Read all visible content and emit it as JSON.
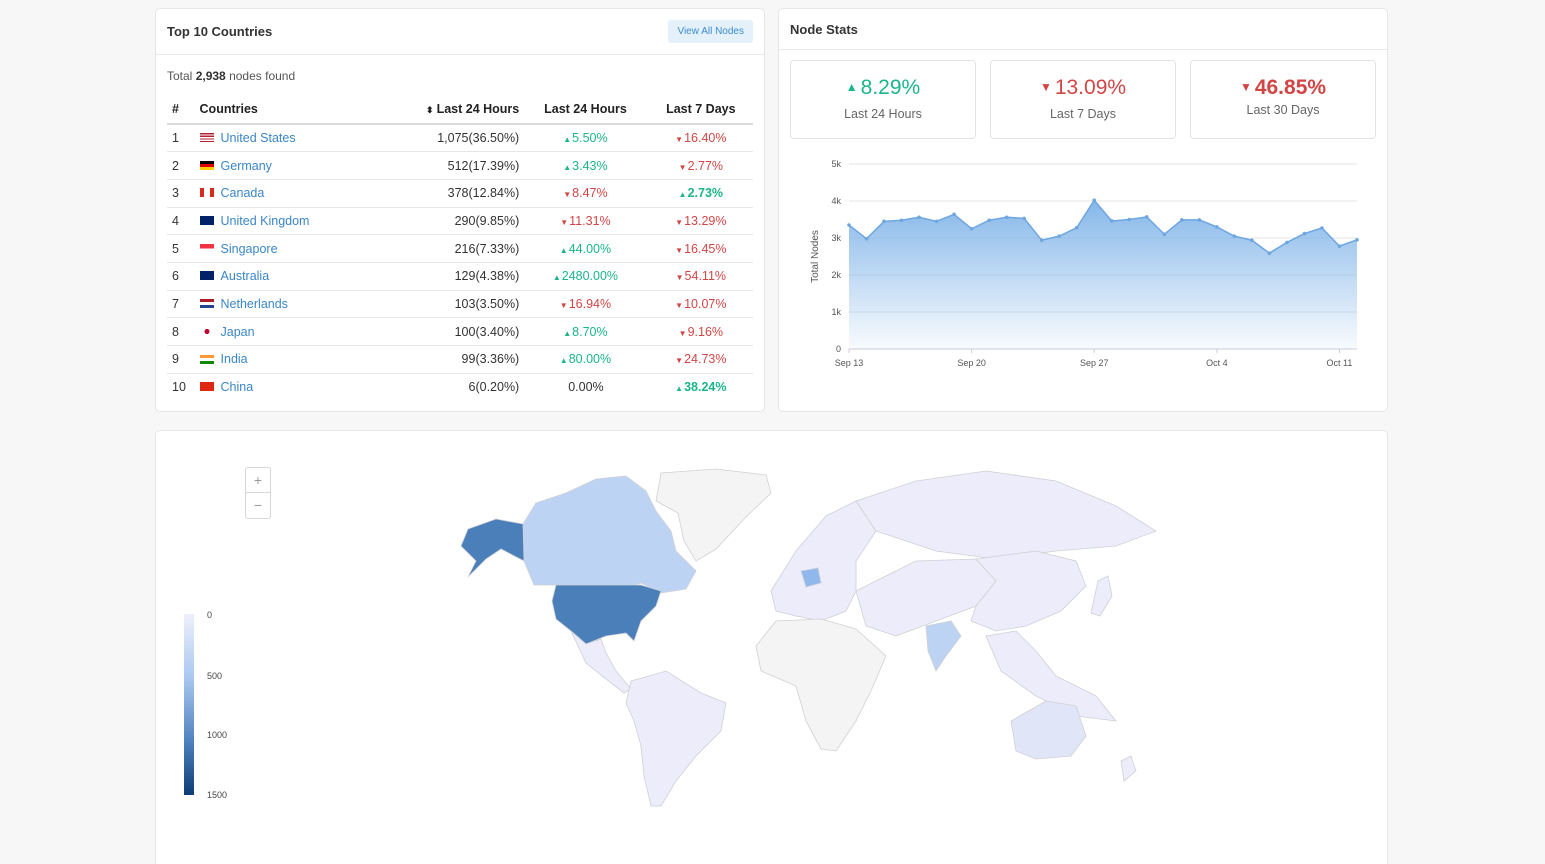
{
  "top_countries": {
    "title": "Top 10 Countries",
    "view_all_label": "View All Nodes",
    "total_prefix": "Total",
    "total_count": "2,938",
    "total_suffix": "nodes found",
    "headers": [
      "#",
      "Countries",
      "Last 24 Hours",
      "Last 24 Hours",
      "Last 7 Days"
    ],
    "rows": [
      {
        "rank": "1",
        "country": "United States",
        "flag": "us",
        "count": "1,075(36.50%)",
        "d24": "5.50%",
        "d24_dir": "up",
        "d7": "16.40%",
        "d7_dir": "down",
        "d7_bold": false
      },
      {
        "rank": "2",
        "country": "Germany",
        "flag": "de",
        "count": "512(17.39%)",
        "d24": "3.43%",
        "d24_dir": "up",
        "d7": "2.77%",
        "d7_dir": "down",
        "d7_bold": false
      },
      {
        "rank": "3",
        "country": "Canada",
        "flag": "ca",
        "count": "378(12.84%)",
        "d24": "8.47%",
        "d24_dir": "down",
        "d7": "2.73%",
        "d7_dir": "up",
        "d7_bold": true
      },
      {
        "rank": "4",
        "country": "United Kingdom",
        "flag": "gb",
        "count": "290(9.85%)",
        "d24": "11.31%",
        "d24_dir": "down",
        "d7": "13.29%",
        "d7_dir": "down",
        "d7_bold": false
      },
      {
        "rank": "5",
        "country": "Singapore",
        "flag": "sg",
        "count": "216(7.33%)",
        "d24": "44.00%",
        "d24_dir": "up",
        "d7": "16.45%",
        "d7_dir": "down",
        "d7_bold": false
      },
      {
        "rank": "6",
        "country": "Australia",
        "flag": "au",
        "count": "129(4.38%)",
        "d24": "2480.00%",
        "d24_dir": "up",
        "d7": "54.11%",
        "d7_dir": "down",
        "d7_bold": false
      },
      {
        "rank": "7",
        "country": "Netherlands",
        "flag": "nl",
        "count": "103(3.50%)",
        "d24": "16.94%",
        "d24_dir": "down",
        "d7": "10.07%",
        "d7_dir": "down",
        "d7_bold": false
      },
      {
        "rank": "8",
        "country": "Japan",
        "flag": "jp",
        "count": "100(3.40%)",
        "d24": "8.70%",
        "d24_dir": "up",
        "d7": "9.16%",
        "d7_dir": "down",
        "d7_bold": false
      },
      {
        "rank": "9",
        "country": "India",
        "flag": "in",
        "count": "99(3.36%)",
        "d24": "80.00%",
        "d24_dir": "up",
        "d7": "24.73%",
        "d7_dir": "down",
        "d7_bold": false
      },
      {
        "rank": "10",
        "country": "China",
        "flag": "cn",
        "count": "6(0.20%)",
        "d24": "0.00%",
        "d24_dir": "none",
        "d7": "38.24%",
        "d7_dir": "up",
        "d7_bold": true
      }
    ]
  },
  "node_stats": {
    "title": "Node Stats",
    "boxes": [
      {
        "value": "8.29%",
        "dir": "up",
        "label": "Last 24 Hours",
        "bold": false
      },
      {
        "value": "13.09%",
        "dir": "down",
        "label": "Last 7 Days",
        "bold": false
      },
      {
        "value": "46.85%",
        "dir": "down",
        "label": "Last 30 Days",
        "bold": true
      }
    ]
  },
  "colors": {
    "up": "#1bb58b",
    "down": "#d24545",
    "link": "#3a86c8",
    "area": "#7fb3e8"
  },
  "chart_data": {
    "type": "area",
    "ylabel": "Total Nodes",
    "xlabel": "",
    "ylim": [
      0,
      5000
    ],
    "yticks": [
      0,
      1000,
      2000,
      3000,
      4000,
      5000
    ],
    "ytick_labels": [
      "0",
      "1k",
      "2k",
      "3k",
      "4k",
      "5k"
    ],
    "xtick_labels": [
      "Sep 13",
      "Sep 20",
      "Sep 27",
      "Oct 4",
      "Oct 11"
    ],
    "xtick_index": [
      0,
      7,
      14,
      21,
      28
    ],
    "dates": [
      "Sep 13",
      "Sep 14",
      "Sep 15",
      "Sep 16",
      "Sep 17",
      "Sep 18",
      "Sep 19",
      "Sep 20",
      "Sep 21",
      "Sep 22",
      "Sep 23",
      "Sep 24",
      "Sep 25",
      "Sep 26",
      "Sep 27",
      "Sep 28",
      "Sep 29",
      "Sep 30",
      "Oct 1",
      "Oct 2",
      "Oct 3",
      "Oct 4",
      "Oct 5",
      "Oct 6",
      "Oct 7",
      "Oct 8",
      "Oct 9",
      "Oct 10",
      "Oct 11",
      "Oct 12"
    ],
    "values": [
      3350,
      2980,
      3450,
      3480,
      3560,
      3450,
      3640,
      3250,
      3480,
      3560,
      3530,
      2940,
      3050,
      3280,
      4020,
      3460,
      3500,
      3570,
      3100,
      3490,
      3490,
      3300,
      3050,
      2940,
      2590,
      2880,
      3120,
      3270,
      2780,
      2950
    ],
    "grid": true,
    "legend": "none"
  },
  "world_map": {
    "zoom_in": "+",
    "zoom_out": "−",
    "legend_labels": [
      "0",
      "500",
      "1000",
      "1500"
    ]
  }
}
